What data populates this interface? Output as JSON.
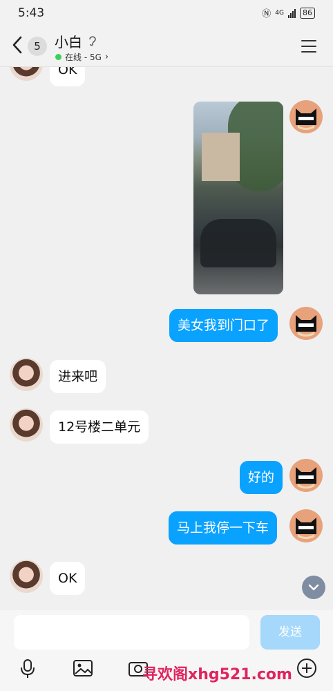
{
  "status_bar": {
    "time": "5:43",
    "network": "4G",
    "battery": "86"
  },
  "header": {
    "back_icon": "back-chevron-icon",
    "unread_count": "5",
    "contact_name": "小白",
    "presence_text": "在线 - 5G",
    "presence_color": "#3ccf5e"
  },
  "messages": [
    {
      "side": "in",
      "type": "text",
      "text": "OK"
    },
    {
      "side": "out",
      "type": "image"
    },
    {
      "side": "out",
      "type": "text",
      "text": "美女我到门口了"
    },
    {
      "side": "in",
      "type": "text",
      "text": "进来吧"
    },
    {
      "side": "in",
      "type": "text",
      "text": "12号楼二单元"
    },
    {
      "side": "out",
      "type": "text",
      "text": "好的"
    },
    {
      "side": "out",
      "type": "text",
      "text": "马上我停一下车"
    },
    {
      "side": "in",
      "type": "text",
      "text": "OK"
    }
  ],
  "composer": {
    "placeholder": "",
    "send_label": "发送",
    "tools": [
      "microphone-icon",
      "image-icon",
      "camera-icon",
      "plus-icon"
    ]
  },
  "watermark": "寻欢阁xhg521.com",
  "colors": {
    "outgoing_bubble": "#0aa2ff",
    "send_button": "#a5d8fb",
    "background": "#f0f0f0"
  }
}
